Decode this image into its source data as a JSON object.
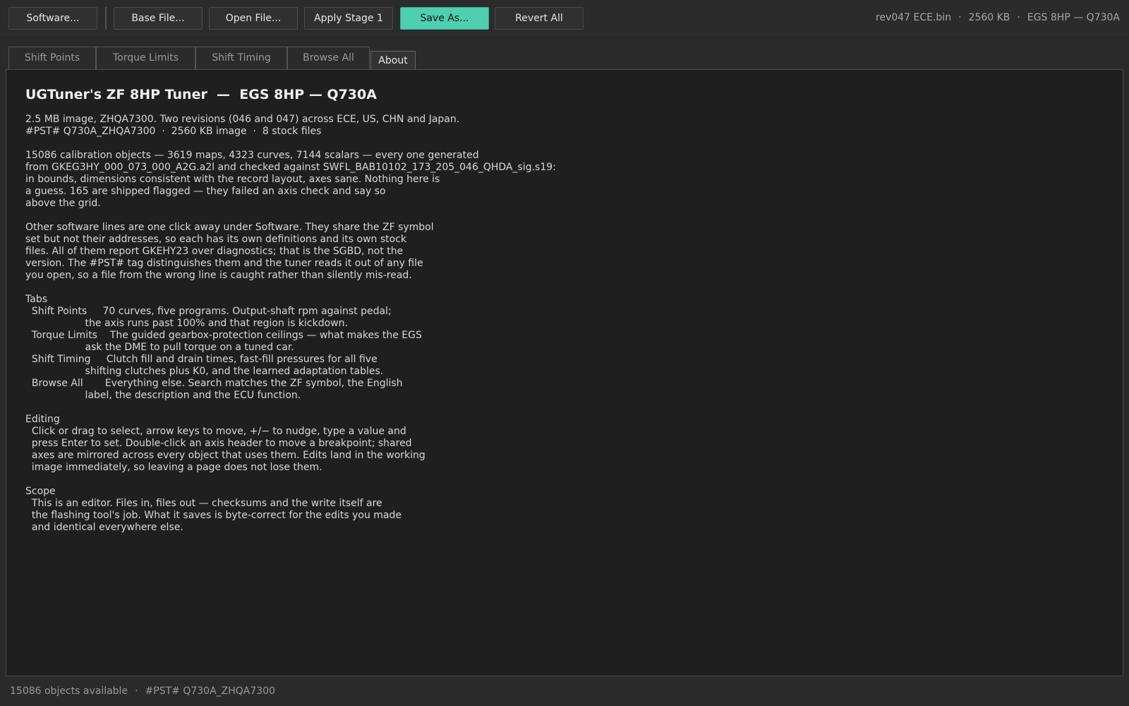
{
  "toolbar": {
    "software_label": "Software...",
    "base_file_label": "Base File...",
    "open_file_label": "Open File...",
    "apply_stage_label": "Apply Stage 1",
    "save_as_label": "Save As...",
    "revert_all_label": "Revert All",
    "accent_color": "#4ecfb0"
  },
  "file_info": {
    "filename": "rev047 ECE.bin",
    "size": "2560 KB",
    "ecu": "EGS 8HP — Q730A",
    "separator": "·"
  },
  "tabs": [
    {
      "label": "Shift Points",
      "active": false
    },
    {
      "label": "Torque Limits",
      "active": false
    },
    {
      "label": "Shift Timing",
      "active": false
    },
    {
      "label": "Browse All",
      "active": false
    },
    {
      "label": "About",
      "active": true
    }
  ],
  "about": {
    "title": "UGTuner's ZF 8HP Tuner  —  EGS 8HP — Q730A",
    "body": "2.5 MB image, ZHQA7300. Two revisions (046 and 047) across ECE, US, CHN and Japan.\n#PST# Q730A_ZHQA7300  ·  2560 KB image  ·  8 stock files\n\n15086 calibration objects — 3619 maps, 4323 curves, 7144 scalars — every one generated\nfrom GKEG3HY_000_073_000_A2G.a2l and checked against SWFL_BAB10102_173_205_046_QHDA_sig.s19:\nin bounds, dimensions consistent with the record layout, axes sane. Nothing here is\na guess. 165 are shipped flagged — they failed an axis check and say so\nabove the grid.\n\nOther software lines are one click away under Software. They share the ZF symbol\nset but not their addresses, so each has its own definitions and its own stock\nfiles. All of them report GKEHY23 over diagnostics; that is the SGBD, not the\nversion. The #PST# tag distinguishes them and the tuner reads it out of any file\nyou open, so a file from the wrong line is caught rather than silently mis-read.\n\nTabs\n  Shift Points     70 curves, five programs. Output-shaft rpm against pedal;\n                   the axis runs past 100% and that region is kickdown.\n  Torque Limits    The guided gearbox-protection ceilings — what makes the EGS\n                   ask the DME to pull torque on a tuned car.\n  Shift Timing     Clutch fill and drain times, fast-fill pressures for all five\n                   shifting clutches plus K0, and the learned adaptation tables.\n  Browse All       Everything else. Search matches the ZF symbol, the English\n                   label, the description and the ECU function.\n\nEditing\n  Click or drag to select, arrow keys to move, +/− to nudge, type a value and\n  press Enter to set. Double-click an axis header to move a breakpoint; shared\n  axes are mirrored across every object that uses them. Edits land in the working\n  image immediately, so leaving a page does not lose them.\n\nScope\n  This is an editor. Files in, files out — checksums and the write itself are\n  the flashing tool's job. What it saves is byte-correct for the edits you made\n  and identical everywhere else."
  },
  "status": {
    "objects": "15086 objects available",
    "separator": "·",
    "pst": "#PST# Q730A_ZHQA7300"
  }
}
